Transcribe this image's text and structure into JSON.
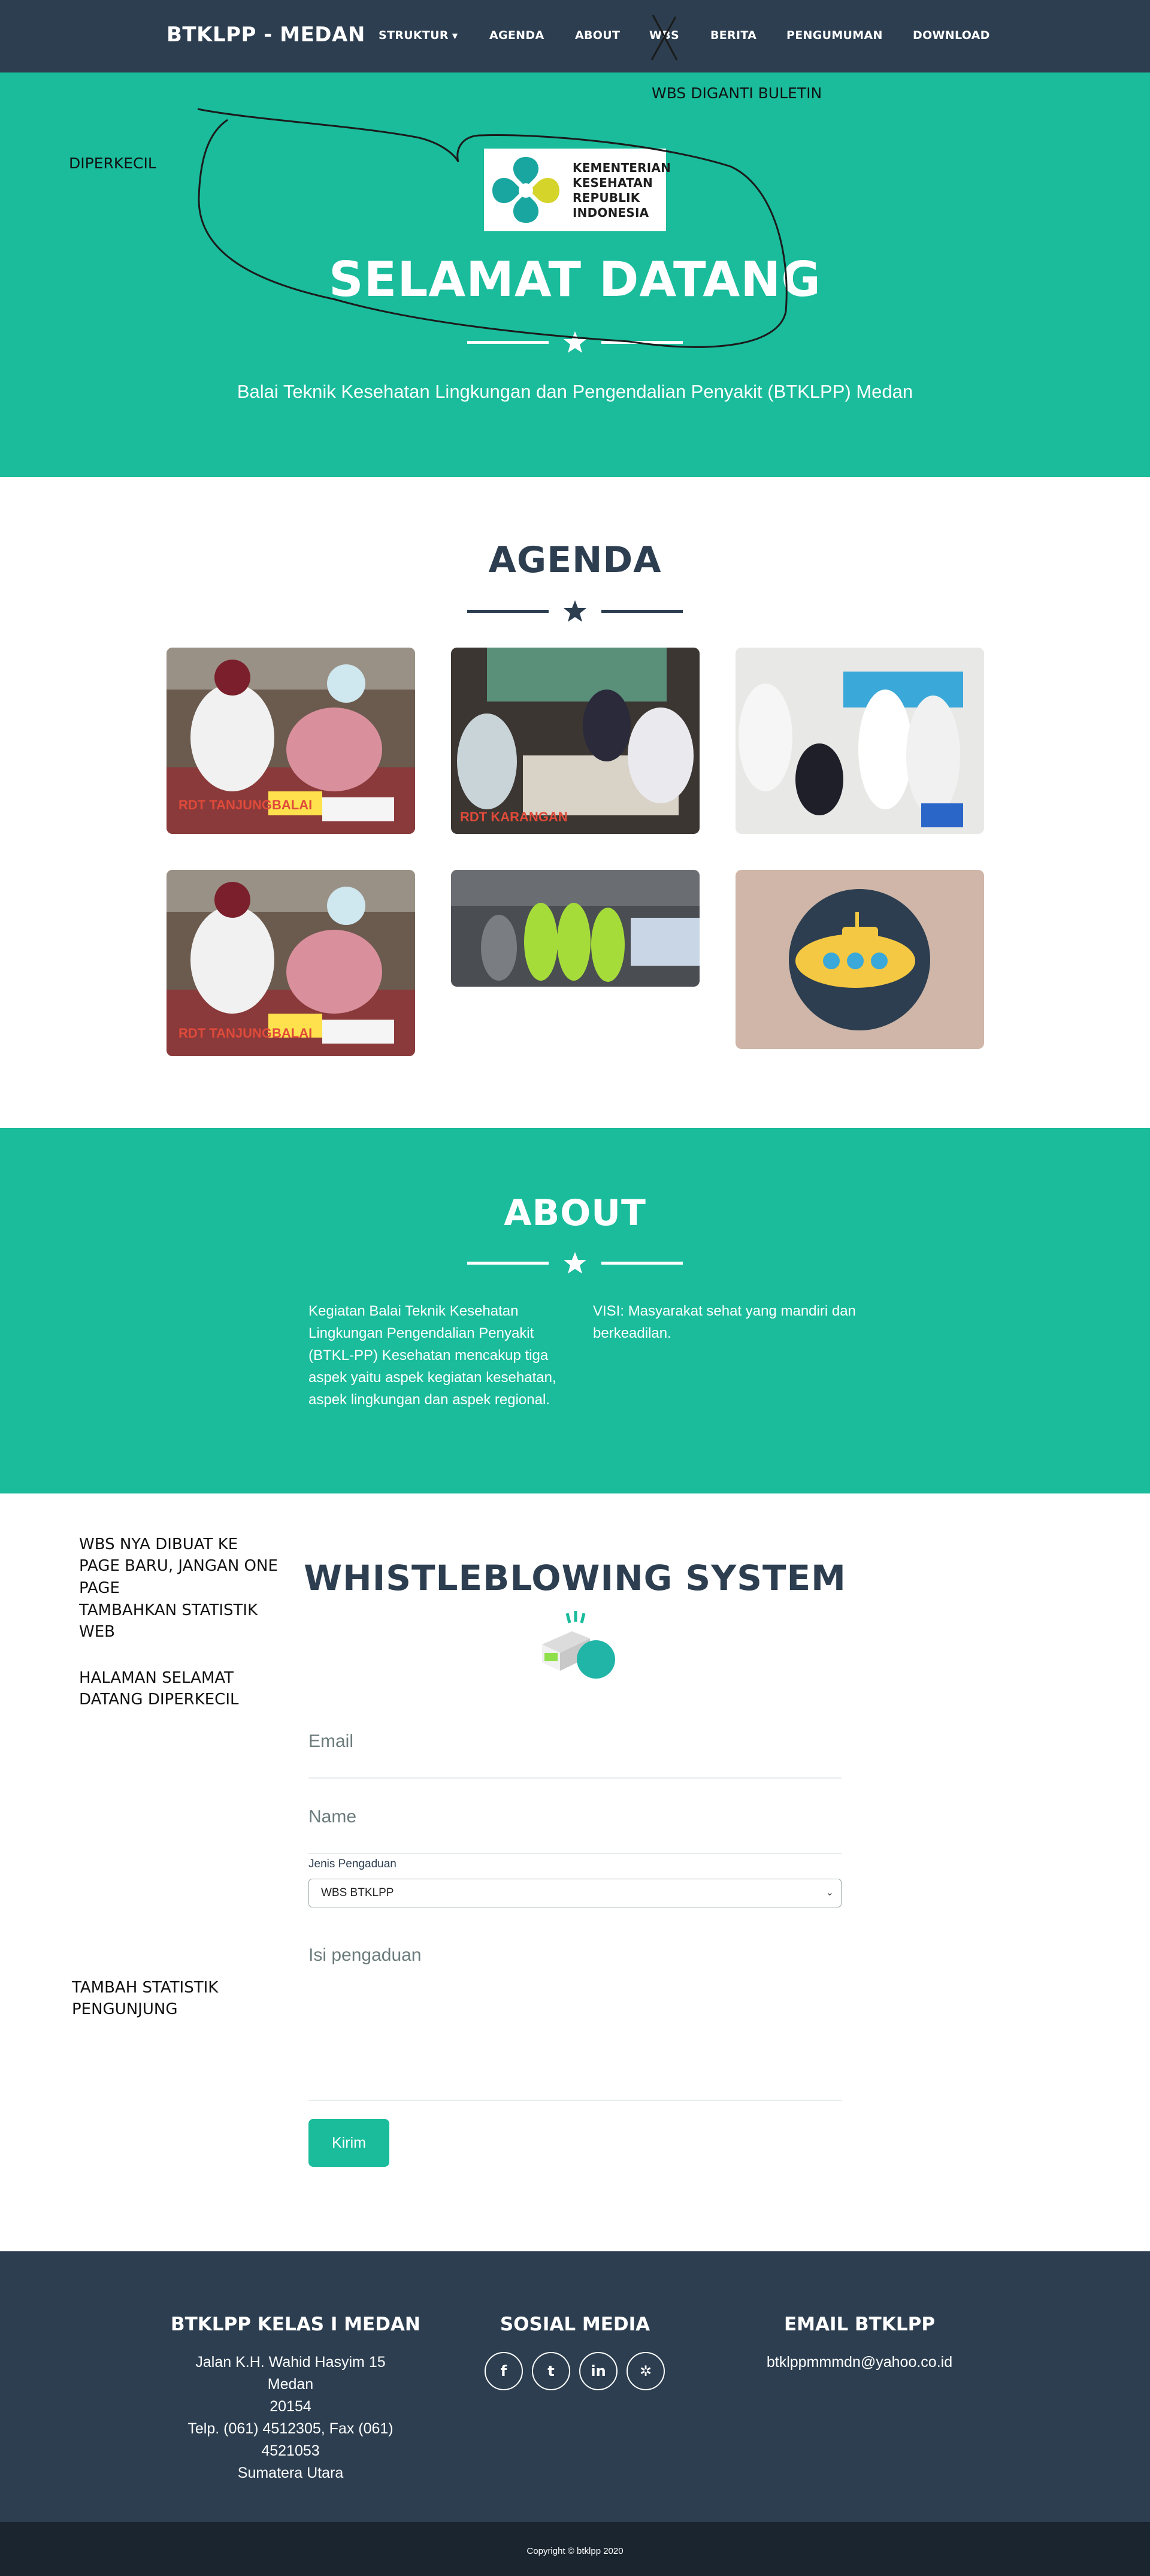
{
  "navbar": {
    "brand": "BTKLPP - MEDAN",
    "items": [
      {
        "label": "STRUKTUR"
      },
      {
        "label": "AGENDA"
      },
      {
        "label": "ABOUT"
      },
      {
        "label": "WBS"
      },
      {
        "label": "BERITA"
      },
      {
        "label": "PENGUMUMAN"
      },
      {
        "label": "DOWNLOAD"
      }
    ]
  },
  "annotations": {
    "wbs_note": "WBS DIGANTI BULETIN",
    "header_note": "DIPERKECIL",
    "side_notes": [
      "WBS NYA DIBUAT KE PAGE BARU, JANGAN ONE PAGE",
      "TAMBAHKAN STATISTIK WEB",
      "HALAMAN SELAMAT DATANG DIPERKECIL",
      "TAMBAH STATISTIK PENGUNJUNG"
    ]
  },
  "header": {
    "logo_text": [
      "KEMENTERIAN",
      "KESEHATAN",
      "REPUBLIK",
      "INDONESIA"
    ],
    "title": "SELAMAT DATANG",
    "subtitle": "Balai Teknik Kesehatan Lingkungan dan Pengendalian Penyakit (BTKLPP) Medan"
  },
  "agenda": {
    "title": "AGENDA",
    "photo_captions": [
      "RDT TANJUNGBALAI",
      "RDT KARANGAN"
    ]
  },
  "about": {
    "title": "ABOUT",
    "left": "Kegiatan Balai Teknik Kesehatan Lingkungan Pengendalian Penyakit (BTKL-PP) Kesehatan mencakup tiga aspek yaitu aspek kegiatan kesehatan, aspek lingkungan dan aspek regional.",
    "right": "VISI: Masyarakat sehat yang mandiri dan berkeadilan."
  },
  "wbs": {
    "title": "WHISTLEBLOWING SYSTEM",
    "email_placeholder": "Email",
    "name_placeholder": "Name",
    "type_label": "Jenis Pengaduan",
    "type_value": "WBS BTKLPP",
    "content_placeholder": "Isi pengaduan",
    "submit": "Kirim"
  },
  "footer": {
    "col1_title": "BTKLPP KELAS I MEDAN",
    "address": [
      "Jalan K.H. Wahid Hasyim 15 Medan",
      "20154",
      "Telp. (061) 4512305, Fax (061)",
      "4521053",
      "Sumatera Utara"
    ],
    "col2_title": "SOSIAL MEDIA",
    "social": [
      {
        "icon": "facebook-icon",
        "glyph": "f"
      },
      {
        "icon": "twitter-icon",
        "glyph": "t"
      },
      {
        "icon": "linkedin-icon",
        "glyph": "in"
      },
      {
        "icon": "dribbble-icon",
        "glyph": "✲"
      }
    ],
    "col3_title": "EMAIL BTKLPP",
    "email": "btklppmmmdn@yahoo.co.id",
    "copyright": "Copyright © btklpp 2020"
  },
  "colors": {
    "primary": "#2c3e50",
    "accent": "#1abc9c",
    "footer_bottom": "#1a252f"
  }
}
